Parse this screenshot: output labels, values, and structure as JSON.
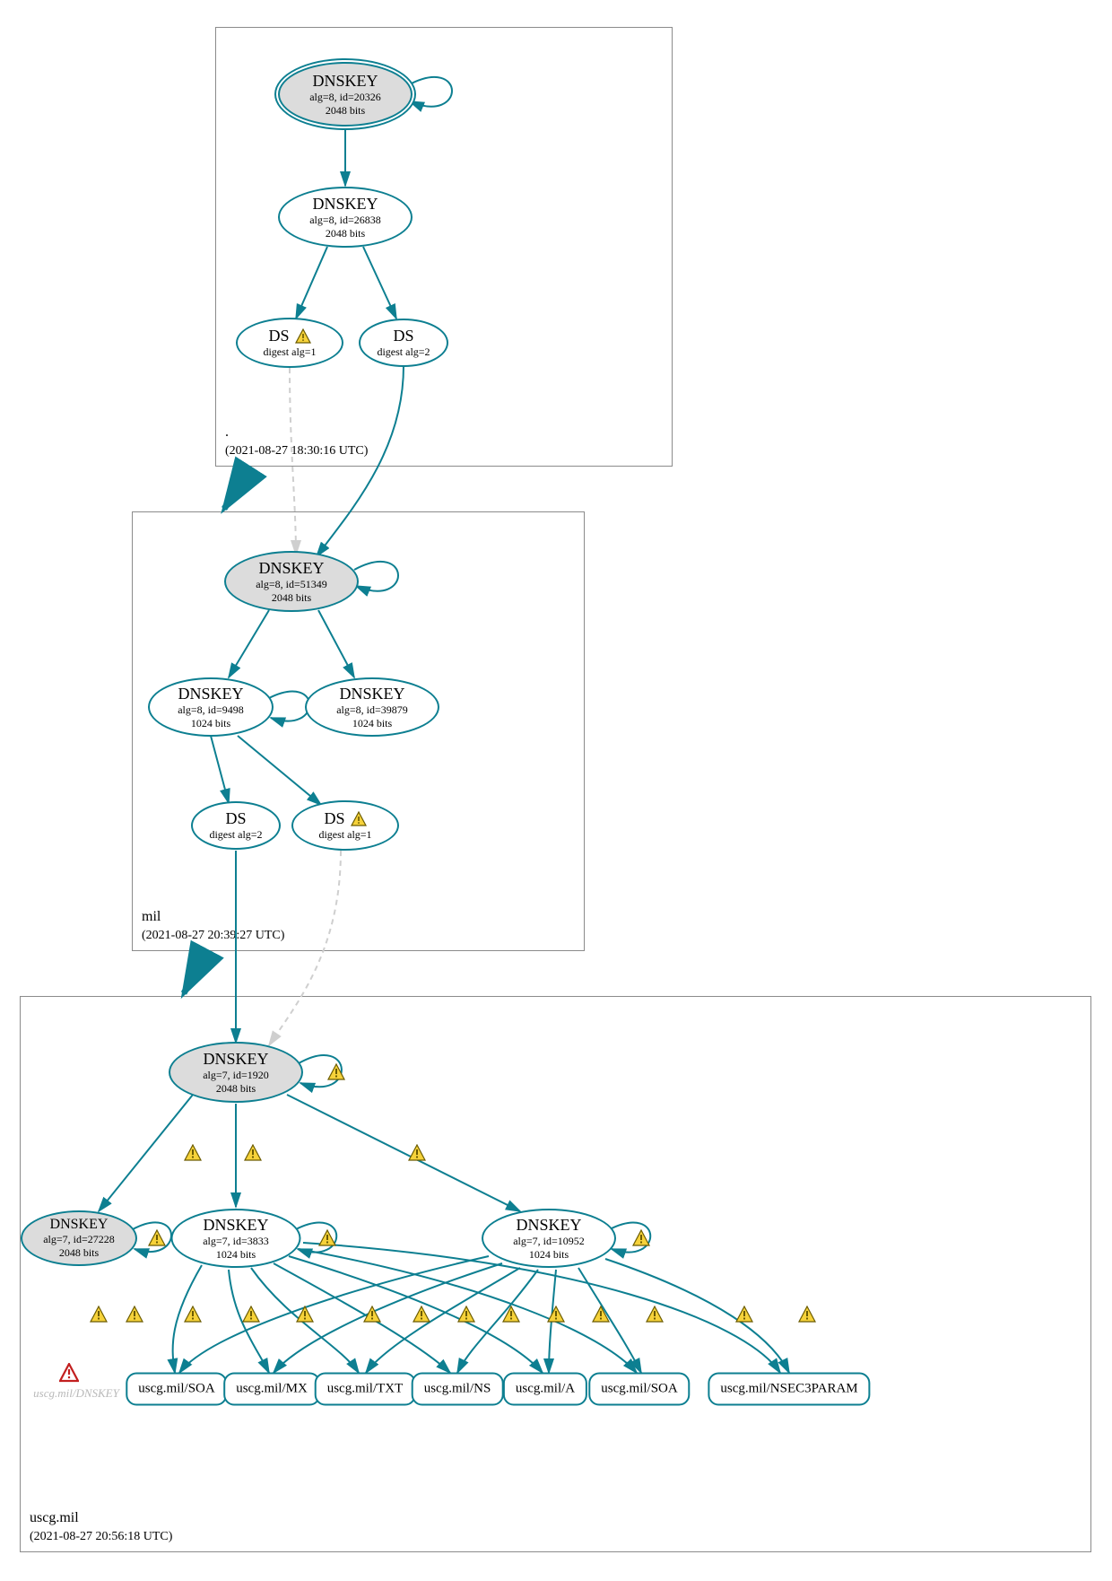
{
  "colors": {
    "stroke": "#0d7f91",
    "grey_fill": "#dcdcdc",
    "box_stroke": "#8b8b8b",
    "warn_fill": "#f6d23a",
    "warn_stroke": "#6b5b00",
    "danger_stroke": "#c21f1f",
    "dashed": "#cfcfcf"
  },
  "zones": {
    "root": {
      "name": ".",
      "timestamp": "(2021-08-27 18:30:16 UTC)"
    },
    "mil": {
      "name": "mil",
      "timestamp": "(2021-08-27 20:39:27 UTC)"
    },
    "uscg": {
      "name": "uscg.mil",
      "timestamp": "(2021-08-27 20:56:18 UTC)"
    }
  },
  "nodes": {
    "root_ksk": {
      "title": "DNSKEY",
      "sub": "alg=8, id=20326",
      "sub2": "2048 bits"
    },
    "root_zsk": {
      "title": "DNSKEY",
      "sub": "alg=8, id=26838",
      "sub2": "2048 bits"
    },
    "root_ds1": {
      "title": "DS",
      "sub": "digest alg=1"
    },
    "root_ds2": {
      "title": "DS",
      "sub": "digest alg=2"
    },
    "mil_ksk": {
      "title": "DNSKEY",
      "sub": "alg=8, id=51349",
      "sub2": "2048 bits"
    },
    "mil_zsk_a": {
      "title": "DNSKEY",
      "sub": "alg=8, id=9498",
      "sub2": "1024 bits"
    },
    "mil_zsk_b": {
      "title": "DNSKEY",
      "sub": "alg=8, id=39879",
      "sub2": "1024 bits"
    },
    "mil_ds2": {
      "title": "DS",
      "sub": "digest alg=2"
    },
    "mil_ds1": {
      "title": "DS",
      "sub": "digest alg=1"
    },
    "uscg_ksk": {
      "title": "DNSKEY",
      "sub": "alg=7, id=1920",
      "sub2": "2048 bits"
    },
    "uscg_key_inactive": {
      "title": "DNSKEY",
      "sub": "alg=7, id=27228",
      "sub2": "2048 bits"
    },
    "uscg_zsk_a": {
      "title": "DNSKEY",
      "sub": "alg=7, id=3833",
      "sub2": "1024 bits"
    },
    "uscg_zsk_b": {
      "title": "DNSKEY",
      "sub": "alg=7, id=10952",
      "sub2": "1024 bits"
    }
  },
  "records": {
    "soa1": "uscg.mil/SOA",
    "mx": "uscg.mil/MX",
    "txt": "uscg.mil/TXT",
    "ns": "uscg.mil/NS",
    "a": "uscg.mil/A",
    "soa2": "uscg.mil/SOA",
    "nsec3": "uscg.mil/NSEC3PARAM"
  },
  "missing_key_label": "uscg.mil/DNSKEY",
  "chart_data": {
    "type": "diagram",
    "description": "DNSSEC authentication graph (DNSViz-style) showing the chain of trust from the root zone through the 'mil' TLD to the 'uscg.mil' zone. Nodes are DNSKEYs, DS records, and RRsets. Edges are RRSIG / DS delegation links. Grey-filled DNSKEYs are KSKs (secure-entry-point). Yellow triangles are warnings on the associated signature or digest. A red hollow triangle marks a missing/insecure DNSKEY reference.",
    "zones": [
      {
        "name": ".",
        "captured": "2021-08-27 18:30:16 UTC"
      },
      {
        "name": "mil",
        "captured": "2021-08-27 20:39:27 UTC"
      },
      {
        "name": "uscg.mil",
        "captured": "2021-08-27 20:56:18 UTC"
      }
    ],
    "nodes": [
      {
        "id": "root_ksk",
        "zone": ".",
        "type": "DNSKEY",
        "alg": 8,
        "key_id": 20326,
        "bits": 2048,
        "ksk": true,
        "trust_anchor": true
      },
      {
        "id": "root_zsk",
        "zone": ".",
        "type": "DNSKEY",
        "alg": 8,
        "key_id": 26838,
        "bits": 2048,
        "ksk": false
      },
      {
        "id": "root_ds1",
        "zone": ".",
        "type": "DS",
        "digest_alg": 1,
        "warning": true
      },
      {
        "id": "root_ds2",
        "zone": ".",
        "type": "DS",
        "digest_alg": 2
      },
      {
        "id": "mil_ksk",
        "zone": "mil",
        "type": "DNSKEY",
        "alg": 8,
        "key_id": 51349,
        "bits": 2048,
        "ksk": true
      },
      {
        "id": "mil_zsk_a",
        "zone": "mil",
        "type": "DNSKEY",
        "alg": 8,
        "key_id": 9498,
        "bits": 1024,
        "ksk": false
      },
      {
        "id": "mil_zsk_b",
        "zone": "mil",
        "type": "DNSKEY",
        "alg": 8,
        "key_id": 39879,
        "bits": 1024,
        "ksk": false
      },
      {
        "id": "mil_ds2",
        "zone": "mil",
        "type": "DS",
        "digest_alg": 2
      },
      {
        "id": "mil_ds1",
        "zone": "mil",
        "type": "DS",
        "digest_alg": 1,
        "warning": true
      },
      {
        "id": "uscg_ksk",
        "zone": "uscg.mil",
        "type": "DNSKEY",
        "alg": 7,
        "key_id": 1920,
        "bits": 2048,
        "ksk": true
      },
      {
        "id": "uscg_key_inactive",
        "zone": "uscg.mil",
        "type": "DNSKEY",
        "alg": 7,
        "key_id": 27228,
        "bits": 2048,
        "ksk": true
      },
      {
        "id": "uscg_zsk_a",
        "zone": "uscg.mil",
        "type": "DNSKEY",
        "alg": 7,
        "key_id": 3833,
        "bits": 1024,
        "ksk": false
      },
      {
        "id": "uscg_zsk_b",
        "zone": "uscg.mil",
        "type": "DNSKEY",
        "alg": 7,
        "key_id": 10952,
        "bits": 1024,
        "ksk": false
      },
      {
        "id": "rec_soa1",
        "zone": "uscg.mil",
        "type": "RRset",
        "name": "uscg.mil/SOA"
      },
      {
        "id": "rec_mx",
        "zone": "uscg.mil",
        "type": "RRset",
        "name": "uscg.mil/MX"
      },
      {
        "id": "rec_txt",
        "zone": "uscg.mil",
        "type": "RRset",
        "name": "uscg.mil/TXT"
      },
      {
        "id": "rec_ns",
        "zone": "uscg.mil",
        "type": "RRset",
        "name": "uscg.mil/NS"
      },
      {
        "id": "rec_a",
        "zone": "uscg.mil",
        "type": "RRset",
        "name": "uscg.mil/A"
      },
      {
        "id": "rec_soa2",
        "zone": "uscg.mil",
        "type": "RRset",
        "name": "uscg.mil/SOA"
      },
      {
        "id": "rec_nsec3",
        "zone": "uscg.mil",
        "type": "RRset",
        "name": "uscg.mil/NSEC3PARAM"
      },
      {
        "id": "uscg_missing_key",
        "zone": "uscg.mil",
        "type": "DNSKEY-ref",
        "name": "uscg.mil/DNSKEY",
        "error": true
      }
    ],
    "edges": [
      {
        "from": "root_ksk",
        "to": "root_ksk",
        "kind": "self-sig"
      },
      {
        "from": "root_ksk",
        "to": "root_zsk",
        "kind": "sig"
      },
      {
        "from": "root_zsk",
        "to": "root_ds1",
        "kind": "sig"
      },
      {
        "from": "root_zsk",
        "to": "root_ds2",
        "kind": "sig"
      },
      {
        "from": "root_ds1",
        "to": "mil_ksk",
        "kind": "ds",
        "style": "dashed-grey"
      },
      {
        "from": "root_ds2",
        "to": "mil_ksk",
        "kind": "ds"
      },
      {
        "from": "mil_ksk",
        "to": "mil_ksk",
        "kind": "self-sig"
      },
      {
        "from": "mil_ksk",
        "to": "mil_zsk_a",
        "kind": "sig"
      },
      {
        "from": "mil_ksk",
        "to": "mil_zsk_b",
        "kind": "sig"
      },
      {
        "from": "mil_zsk_a",
        "to": "mil_ds2",
        "kind": "sig"
      },
      {
        "from": "mil_zsk_a",
        "to": "mil_ds1",
        "kind": "sig"
      },
      {
        "from": "mil_ds2",
        "to": "uscg_ksk",
        "kind": "ds"
      },
      {
        "from": "mil_ds1",
        "to": "uscg_ksk",
        "kind": "ds",
        "style": "dashed-grey"
      },
      {
        "from": "uscg_ksk",
        "to": "uscg_ksk",
        "kind": "self-sig",
        "warning": true
      },
      {
        "from": "uscg_ksk",
        "to": "uscg_key_inactive",
        "kind": "sig",
        "warning": true
      },
      {
        "from": "uscg_ksk",
        "to": "uscg_zsk_a",
        "kind": "sig",
        "warning": true
      },
      {
        "from": "uscg_ksk",
        "to": "uscg_zsk_b",
        "kind": "sig",
        "warning": true
      },
      {
        "from": "uscg_key_inactive",
        "to": "uscg_key_inactive",
        "kind": "self-sig",
        "warning": true
      },
      {
        "from": "uscg_zsk_a",
        "to": "uscg_zsk_a",
        "kind": "self-sig",
        "warning": true
      },
      {
        "from": "uscg_zsk_b",
        "to": "uscg_zsk_b",
        "kind": "self-sig",
        "warning": true
      },
      {
        "from": "uscg_zsk_a",
        "to": "rec_soa1",
        "kind": "sig",
        "warning": true
      },
      {
        "from": "uscg_zsk_a",
        "to": "rec_mx",
        "kind": "sig",
        "warning": true
      },
      {
        "from": "uscg_zsk_a",
        "to": "rec_txt",
        "kind": "sig",
        "warning": true
      },
      {
        "from": "uscg_zsk_a",
        "to": "rec_ns",
        "kind": "sig",
        "warning": true
      },
      {
        "from": "uscg_zsk_a",
        "to": "rec_a",
        "kind": "sig",
        "warning": true
      },
      {
        "from": "uscg_zsk_a",
        "to": "rec_soa2",
        "kind": "sig",
        "warning": true
      },
      {
        "from": "uscg_zsk_a",
        "to": "rec_nsec3",
        "kind": "sig",
        "warning": true
      },
      {
        "from": "uscg_zsk_b",
        "to": "rec_soa1",
        "kind": "sig",
        "warning": true
      },
      {
        "from": "uscg_zsk_b",
        "to": "rec_mx",
        "kind": "sig",
        "warning": true
      },
      {
        "from": "uscg_zsk_b",
        "to": "rec_txt",
        "kind": "sig",
        "warning": true
      },
      {
        "from": "uscg_zsk_b",
        "to": "rec_ns",
        "kind": "sig",
        "warning": true
      },
      {
        "from": "uscg_zsk_b",
        "to": "rec_a",
        "kind": "sig",
        "warning": true
      },
      {
        "from": "uscg_zsk_b",
        "to": "rec_soa2",
        "kind": "sig",
        "warning": true
      },
      {
        "from": "uscg_zsk_b",
        "to": "rec_nsec3",
        "kind": "sig",
        "warning": true
      }
    ]
  }
}
